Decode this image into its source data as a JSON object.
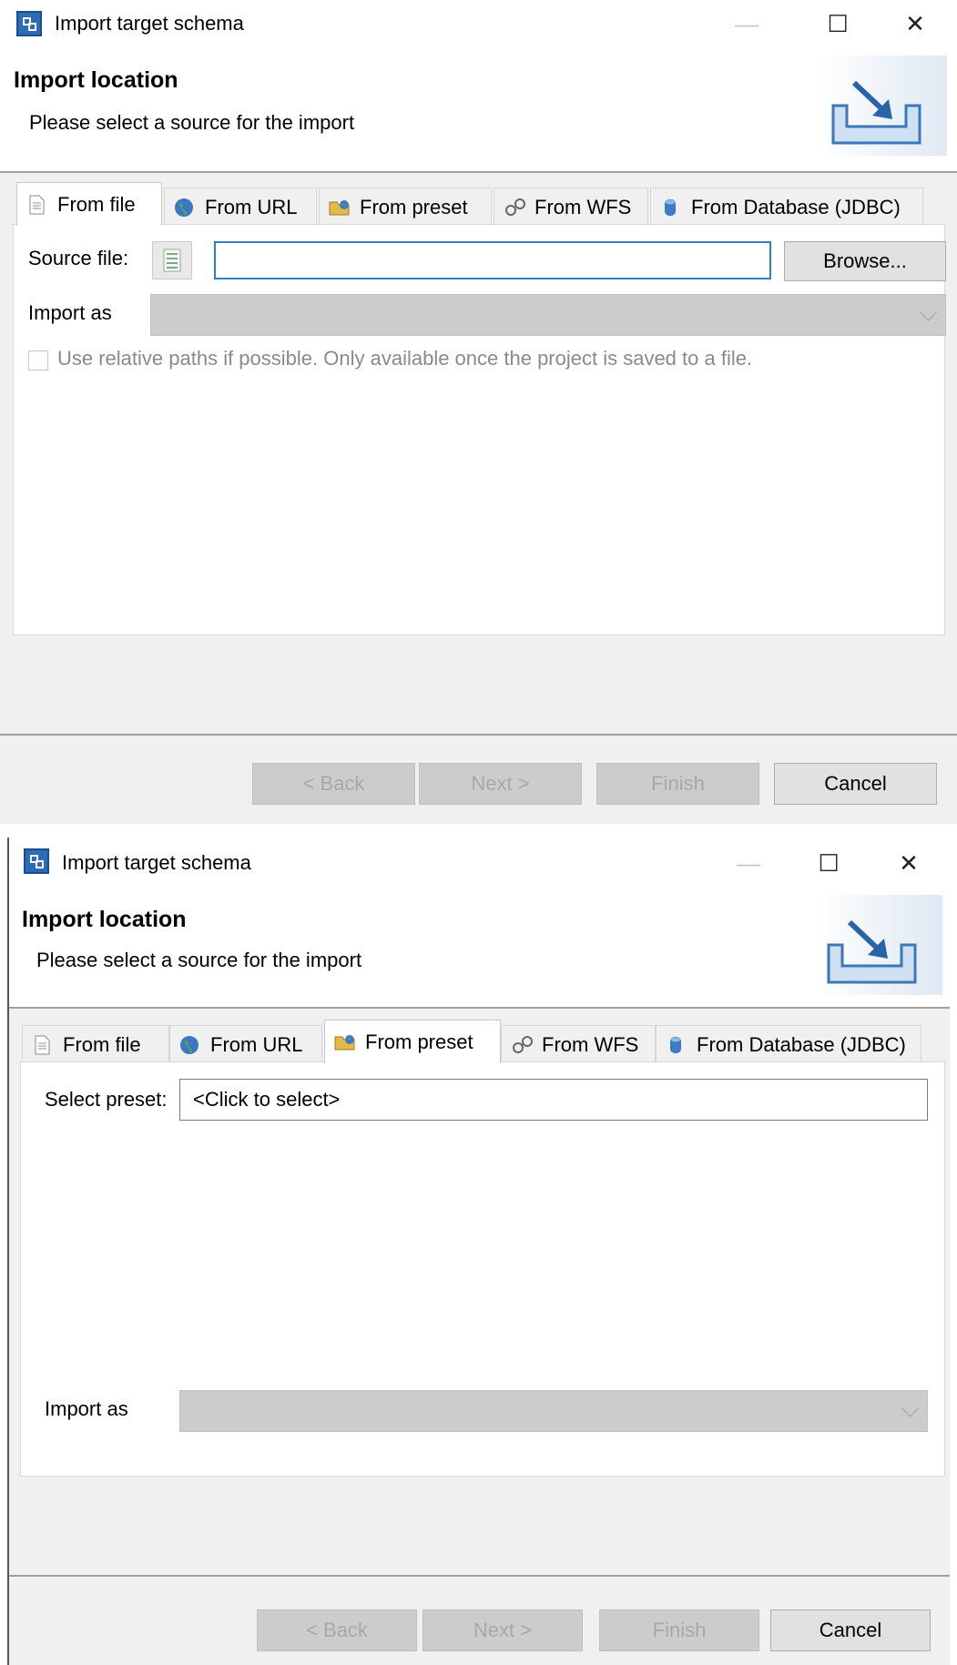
{
  "dialogs": [
    {
      "window_title": "Import target schema",
      "window_controls": {
        "minimize": "—",
        "maximize": "☐",
        "close": "✕"
      },
      "header": {
        "title": "Import location",
        "description": "Please select a source for the import"
      },
      "tabs": [
        {
          "label": "From file",
          "icon": "file-icon",
          "active": true
        },
        {
          "label": "From URL",
          "icon": "globe-icon",
          "active": false
        },
        {
          "label": "From preset",
          "icon": "folder-icon",
          "active": false
        },
        {
          "label": "From WFS",
          "icon": "gears-icon",
          "active": false
        },
        {
          "label": "From Database (JDBC)",
          "icon": "database-icon",
          "active": false
        }
      ],
      "source_file_label": "Source file:",
      "source_file_value": "",
      "browse_label": "Browse...",
      "import_as_label": "Import as",
      "relative_paths_label": "Use relative paths if possible. Only available once the project is saved to a file.",
      "relative_paths_checked": false,
      "buttons": {
        "back": "< Back",
        "next": "Next >",
        "finish": "Finish",
        "cancel": "Cancel"
      }
    },
    {
      "window_title": "Import target schema",
      "window_controls": {
        "minimize": "—",
        "maximize": "☐",
        "close": "✕"
      },
      "header": {
        "title": "Import location",
        "description": "Please select a source for the import"
      },
      "tabs": [
        {
          "label": "From file",
          "icon": "file-icon",
          "active": false
        },
        {
          "label": "From URL",
          "icon": "globe-icon",
          "active": false
        },
        {
          "label": "From preset",
          "icon": "folder-icon",
          "active": true
        },
        {
          "label": "From WFS",
          "icon": "gears-icon",
          "active": false
        },
        {
          "label": "From Database (JDBC)",
          "icon": "database-icon",
          "active": false
        }
      ],
      "select_preset_label": "Select preset:",
      "select_preset_value": "<Click to select>",
      "import_as_label": "Import as",
      "buttons": {
        "back": "< Back",
        "next": "Next >",
        "finish": "Finish",
        "cancel": "Cancel"
      }
    }
  ]
}
